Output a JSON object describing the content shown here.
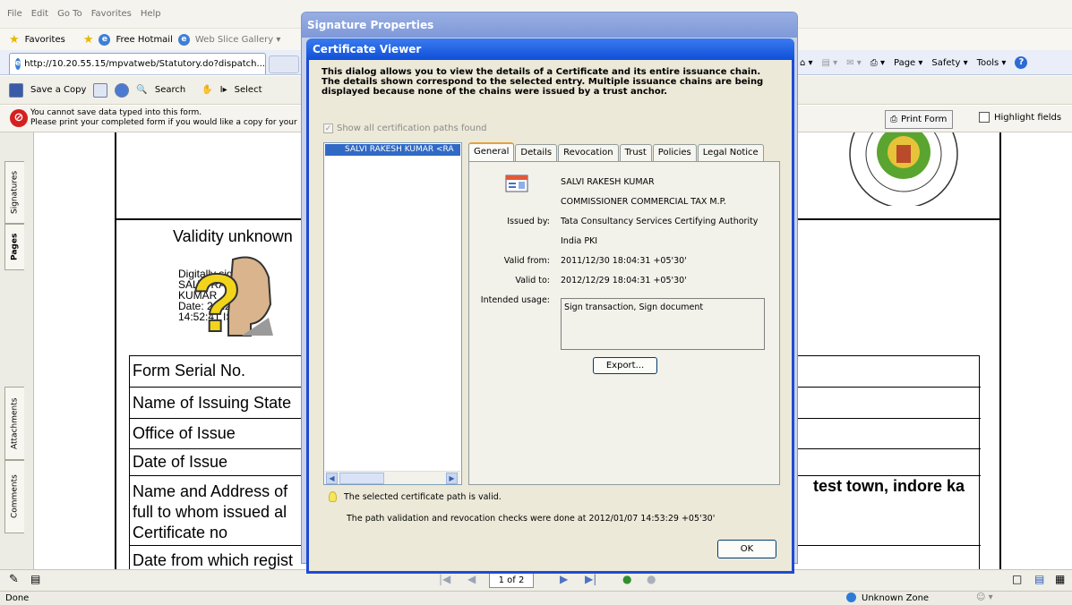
{
  "browser": {
    "menu": [
      "File",
      "Edit",
      "Go To",
      "Favorites",
      "Help"
    ],
    "favorites_label": "Favorites",
    "favorites_items": [
      "Free Hotmail",
      "Web Slice Gallery ▾"
    ],
    "tab_url": "http://10.20.55.15/mpvatweb/Statutory.do?dispatch...",
    "commands": [
      "Page ▾",
      "Safety ▾",
      "Tools ▾"
    ]
  },
  "acrobat": {
    "save_copy": "Save a Copy",
    "search": "Search",
    "select": "Select",
    "msg_line1": "You cannot save data typed into this form.",
    "msg_line2": "Please print your completed form if you would like a copy for your",
    "print_form": "Print Form",
    "highlight_fields": "Highlight fields",
    "side_tabs": [
      "Signatures",
      "Pages",
      "Attachments",
      "Comments"
    ],
    "page_indicator": "1 of 2"
  },
  "document": {
    "validity": "Validity unknown",
    "signed_lines": [
      "Digitally signed by",
      "SALVI RAKESH",
      "KUMAR",
      "Date: 2012.01.07",
      "14:52:41 IST"
    ],
    "rows": [
      "Form Serial No.",
      "Name of Issuing State",
      "Office of Issue",
      "Date of Issue",
      "Name and Address of",
      "full to whom issued al",
      "Certificate no",
      "Date from which regist"
    ],
    "right_text": "test town, indore ka"
  },
  "status": {
    "left": "Done",
    "zone": "Unknown Zone"
  },
  "sig_props_title": "Signature Properties",
  "cert_viewer": {
    "title": "Certificate Viewer",
    "description": "This dialog allows you to view the details of a Certificate and its entire issuance chain. The details shown correspond to the selected entry. Multiple issuance chains are being displayed because none of the chains were issued by a trust anchor.",
    "show_all_paths": "Show all certification paths found",
    "path_entry": "SALVI RAKESH KUMAR <RA",
    "tabs": [
      "General",
      "Details",
      "Revocation",
      "Trust",
      "Policies",
      "Legal Notice"
    ],
    "subject_name": "SALVI RAKESH KUMAR",
    "subject_org": "COMMISSIONER COMMERCIAL TAX M.P.",
    "issued_by_label": "Issued by:",
    "issued_by": "Tata Consultancy Services Certifying Authority",
    "issued_by_org": "India PKI",
    "valid_from_label": "Valid from:",
    "valid_from": "2011/12/30 18:04:31 +05'30'",
    "valid_to_label": "Valid to:",
    "valid_to": "2012/12/29 18:04:31 +05'30'",
    "usage_label": "Intended usage:",
    "usage": "Sign transaction, Sign document",
    "export": "Export...",
    "valid_msg": "The selected certificate path is valid.",
    "revocation_msg": "The path validation and revocation checks were done at 2012/01/07 14:53:29 +05'30'",
    "ok": "OK"
  }
}
